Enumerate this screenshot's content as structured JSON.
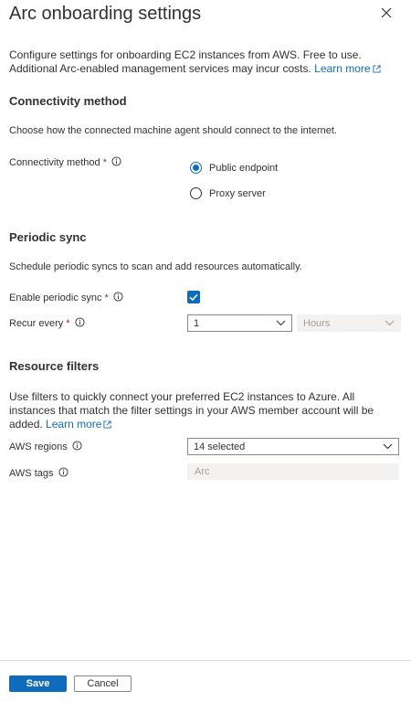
{
  "panel": {
    "title": "Arc onboarding settings",
    "intro_text": "Configure settings for onboarding EC2 instances from AWS. Free to use. Additional Arc-enabled management services may incur costs.",
    "intro_link": "Learn more"
  },
  "connectivity": {
    "heading": "Connectivity method",
    "description": "Choose how the connected machine agent should connect to the internet.",
    "label": "Connectivity method",
    "required_mark": "*",
    "options": [
      {
        "label": "Public endpoint",
        "selected": true
      },
      {
        "label": "Proxy server",
        "selected": false
      }
    ]
  },
  "periodic_sync": {
    "heading": "Periodic sync",
    "description": "Schedule periodic syncs to scan and add resources automatically.",
    "enable_label": "Enable periodic sync",
    "enable_checked": true,
    "recur_label": "Recur every",
    "required_mark": "*",
    "recur_value": "1",
    "recur_unit": "Hours"
  },
  "resource_filters": {
    "heading": "Resource filters",
    "description": "Use filters to quickly connect your preferred EC2 instances to Azure. All instances that match the filter settings in your AWS member account will be added.",
    "link": "Learn more",
    "regions_label": "AWS regions",
    "regions_value": "14 selected",
    "tags_label": "AWS tags",
    "tags_placeholder": "Arc"
  },
  "footer": {
    "save_label": "Save",
    "cancel_label": "Cancel"
  },
  "colors": {
    "accent": "#0f6cbd",
    "required": "#a4262c",
    "text": "#323130"
  }
}
